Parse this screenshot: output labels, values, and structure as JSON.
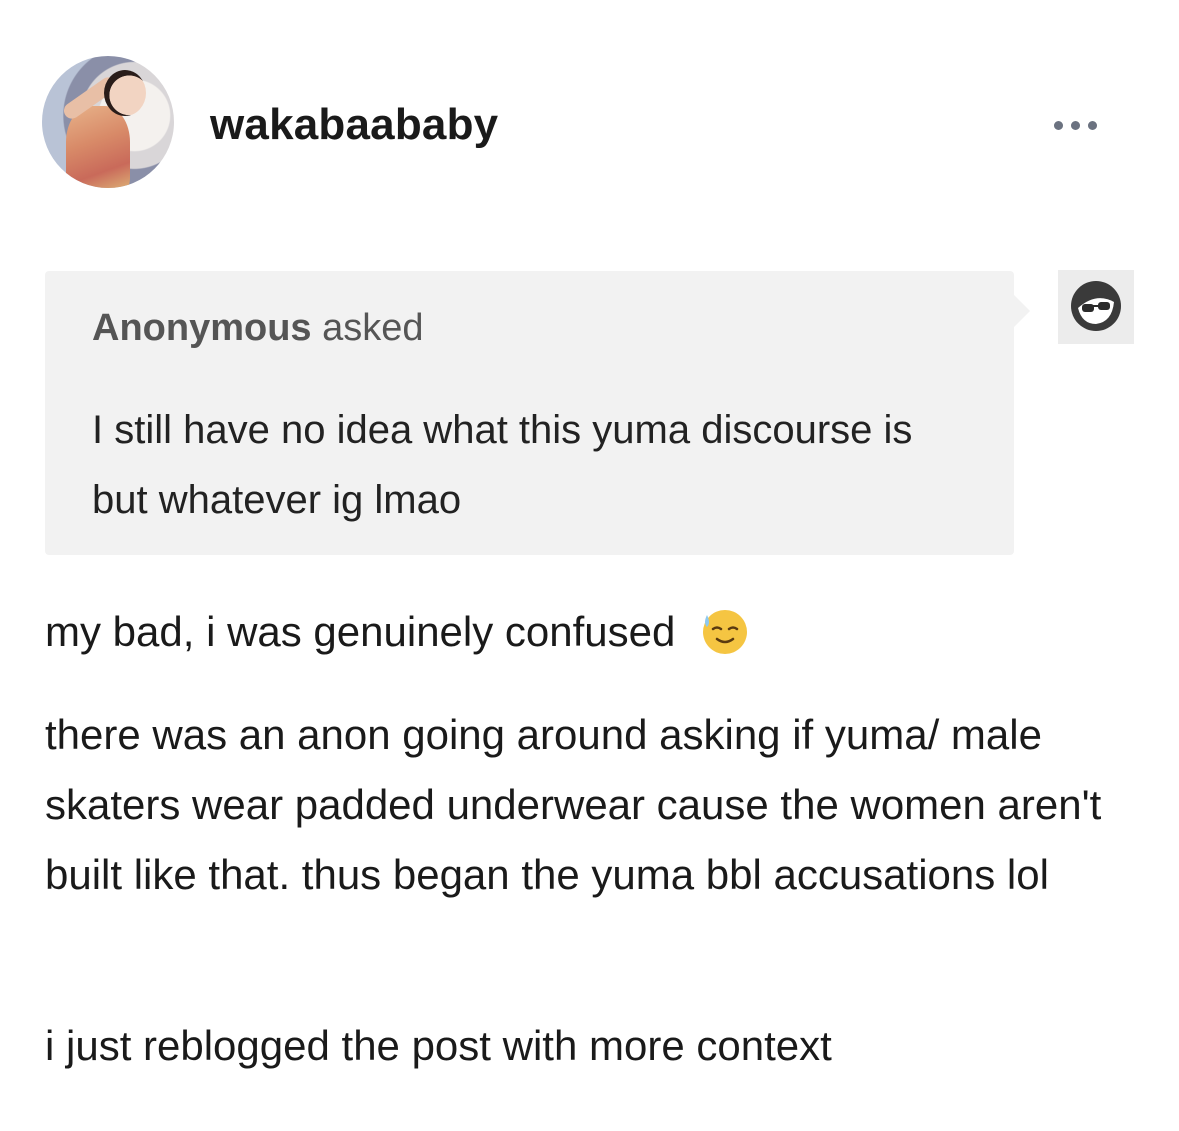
{
  "post": {
    "username": "wakabaababy",
    "avatar_icon": "avatar-photo",
    "more_icon": "more-dots-icon"
  },
  "ask": {
    "asker_name": "Anonymous",
    "asked_label": "asked",
    "question": "I still have no idea what this yuma discourse is but whatever ig lmao",
    "anon_icon": "anonymous-sunglasses-icon"
  },
  "answer": {
    "paragraph_1": "my bad, i was genuinely confused",
    "paragraph_1_emoji": "sweat-smile-emoji",
    "paragraph_2": "there was an anon going around asking if yuma/ male skaters wear padded underwear cause the women aren't built like that. thus began the yuma bbl accusations lol",
    "paragraph_3": "i just reblogged the post with more context"
  },
  "colors": {
    "ask_background": "#f2f2f2",
    "text": "#1a1a1a",
    "muted_text": "#555555",
    "dots": "#6b7280"
  }
}
